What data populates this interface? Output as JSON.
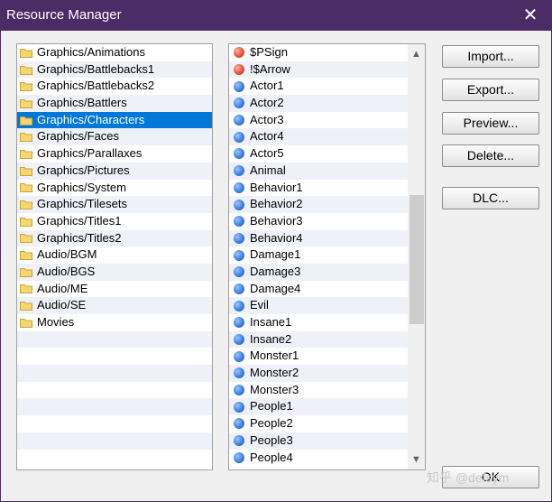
{
  "window": {
    "title": "Resource Manager",
    "close_glyph": "✕"
  },
  "folders": {
    "items": [
      {
        "label": "Graphics/Animations",
        "selected": false
      },
      {
        "label": "Graphics/Battlebacks1",
        "selected": false
      },
      {
        "label": "Graphics/Battlebacks2",
        "selected": false
      },
      {
        "label": "Graphics/Battlers",
        "selected": false
      },
      {
        "label": "Graphics/Characters",
        "selected": true
      },
      {
        "label": "Graphics/Faces",
        "selected": false
      },
      {
        "label": "Graphics/Parallaxes",
        "selected": false
      },
      {
        "label": "Graphics/Pictures",
        "selected": false
      },
      {
        "label": "Graphics/System",
        "selected": false
      },
      {
        "label": "Graphics/Tilesets",
        "selected": false
      },
      {
        "label": "Graphics/Titles1",
        "selected": false
      },
      {
        "label": "Graphics/Titles2",
        "selected": false
      },
      {
        "label": "Audio/BGM",
        "selected": false
      },
      {
        "label": "Audio/BGS",
        "selected": false
      },
      {
        "label": "Audio/ME",
        "selected": false
      },
      {
        "label": "Audio/SE",
        "selected": false
      },
      {
        "label": "Movies",
        "selected": false
      }
    ],
    "icon": "folder-icon",
    "icon_color": "#f5d76e"
  },
  "files": {
    "items": [
      {
        "label": "$PSign",
        "icon": "red-dot-icon"
      },
      {
        "label": "!$Arrow",
        "icon": "red-dot-icon"
      },
      {
        "label": "Actor1",
        "icon": "blue-dot-icon"
      },
      {
        "label": "Actor2",
        "icon": "blue-dot-icon"
      },
      {
        "label": "Actor3",
        "icon": "blue-dot-icon"
      },
      {
        "label": "Actor4",
        "icon": "blue-dot-icon"
      },
      {
        "label": "Actor5",
        "icon": "blue-dot-icon"
      },
      {
        "label": "Animal",
        "icon": "blue-dot-icon"
      },
      {
        "label": "Behavior1",
        "icon": "blue-dot-icon"
      },
      {
        "label": "Behavior2",
        "icon": "blue-dot-icon"
      },
      {
        "label": "Behavior3",
        "icon": "blue-dot-icon"
      },
      {
        "label": "Behavior4",
        "icon": "blue-dot-icon"
      },
      {
        "label": "Damage1",
        "icon": "blue-dot-icon"
      },
      {
        "label": "Damage3",
        "icon": "blue-dot-icon"
      },
      {
        "label": "Damage4",
        "icon": "blue-dot-icon"
      },
      {
        "label": "Evil",
        "icon": "blue-dot-icon"
      },
      {
        "label": "Insane1",
        "icon": "blue-dot-icon"
      },
      {
        "label": "Insane2",
        "icon": "blue-dot-icon"
      },
      {
        "label": "Monster1",
        "icon": "blue-dot-icon"
      },
      {
        "label": "Monster2",
        "icon": "blue-dot-icon"
      },
      {
        "label": "Monster3",
        "icon": "blue-dot-icon"
      },
      {
        "label": "People1",
        "icon": "blue-dot-icon"
      },
      {
        "label": "People2",
        "icon": "blue-dot-icon"
      },
      {
        "label": "People3",
        "icon": "blue-dot-icon"
      },
      {
        "label": "People4",
        "icon": "blue-dot-icon"
      }
    ],
    "scroll_up_glyph": "▲",
    "scroll_down_glyph": "▼"
  },
  "buttons": {
    "import": "Import...",
    "export": "Export...",
    "preview": "Preview...",
    "delete": "Delete...",
    "dlc": "DLC...",
    "ok": "OK"
  },
  "watermark": "知乎 @defsym",
  "colors": {
    "titlebar": "#4b2c67",
    "selection": "#0078d7"
  }
}
